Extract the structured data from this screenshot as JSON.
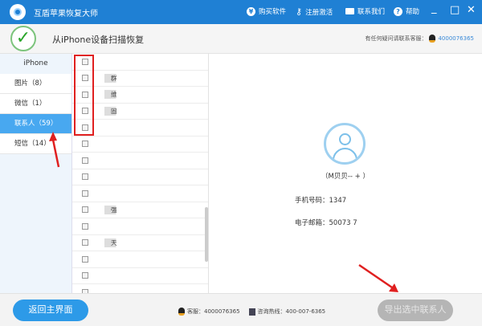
{
  "app": {
    "title": "互盾苹果恢复大师"
  },
  "titlebar": {
    "buy": "购买软件",
    "register": "注册激活",
    "contact": "联系我们",
    "help": "帮助",
    "minimize": "_",
    "maximize": "□",
    "close": "✕"
  },
  "header": {
    "title": "从iPhone设备扫描恢复",
    "support_label": "有任何疑问请联系客服：",
    "support_qq": "4000076365"
  },
  "sidebar": {
    "device": "iPhone",
    "items": [
      {
        "label": "图片（8）"
      },
      {
        "label": "微信（1）"
      },
      {
        "label": "联系人（59）"
      },
      {
        "label": "短信（14）"
      }
    ]
  },
  "contacts": [
    "",
    "群",
    "维",
    "固",
    "",
    "",
    "",
    "",
    "",
    "强",
    "",
    "天",
    "",
    "",
    ""
  ],
  "detail": {
    "name": "（M贝贝-- + ）",
    "phone": "手机号码：1347",
    "email": "电子邮箱：50073 7"
  },
  "footer": {
    "back": "返回主界面",
    "service": "客服：4000076365",
    "hotline": "咨询热线：400-007-6365",
    "export": "导出选中联系人"
  }
}
